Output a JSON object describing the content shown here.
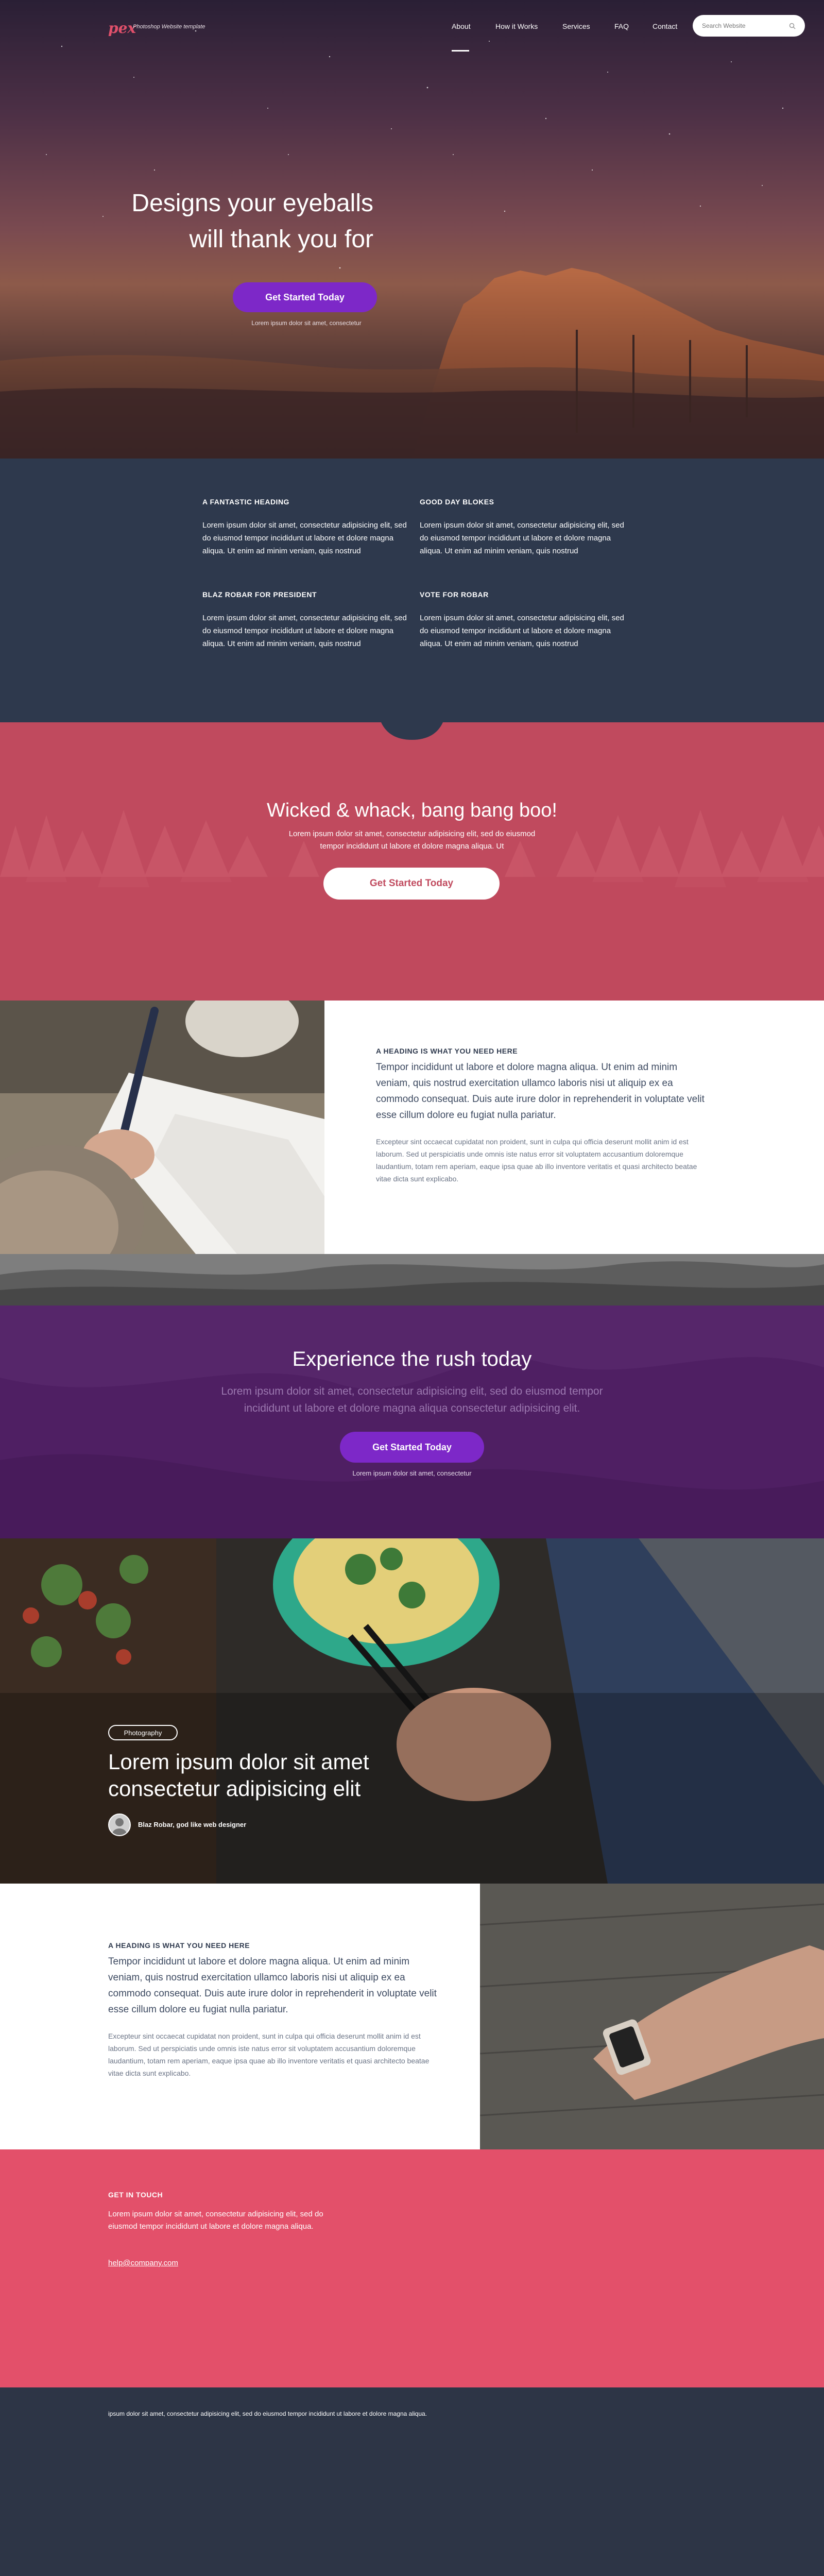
{
  "header": {
    "logo": "pex",
    "tagline": "Photoshop Website template",
    "nav": [
      "About",
      "How it Works",
      "Services",
      "FAQ",
      "Contact"
    ],
    "active_nav": "About",
    "search_placeholder": "Search Website",
    "search_icon": "search-icon"
  },
  "hero": {
    "title_line1": "Designs your eyeballs",
    "title_line2": "will thank you for",
    "button": "Get Started Today",
    "subtext": "Lorem ipsum dolor sit amet, consectetur"
  },
  "features": [
    {
      "heading": "A FANTASTIC HEADING",
      "text": "Lorem ipsum dolor sit amet, consectetur adipisicing elit, sed do eiusmod tempor incididunt ut labore et dolore magna aliqua. Ut enim ad minim veniam, quis nostrud"
    },
    {
      "heading": "GOOD DAY BLOKES",
      "text": "Lorem ipsum dolor sit amet, consectetur adipisicing elit, sed do eiusmod tempor incididunt ut labore et dolore magna aliqua. Ut enim ad minim veniam, quis nostrud"
    },
    {
      "heading": "BLAZ ROBAR FOR PRESIDENT",
      "text": "Lorem ipsum dolor sit amet, consectetur adipisicing elit, sed do eiusmod tempor incididunt ut labore et dolore magna aliqua. Ut enim ad minim veniam, quis nostrud"
    },
    {
      "heading": "VOTE FOR ROBAR",
      "text": "Lorem ipsum dolor sit amet, consectetur adipisicing elit, sed do eiusmod tempor incididunt ut labore et dolore magna aliqua. Ut enim ad minim veniam, quis nostrud"
    }
  ],
  "cta_red": {
    "title": "Wicked & whack, bang bang boo!",
    "text": "Lorem ipsum dolor sit amet, consectetur adipisicing elit, sed do eiusmod tempor incididunt ut labore et dolore magna aliqua. Ut",
    "button": "Get Started Today"
  },
  "split1": {
    "heading": "A HEADING IS WHAT YOU NEED HERE",
    "lead": "Tempor incididunt ut labore et dolore magna aliqua. Ut enim ad minim veniam, quis nostrud exercitation ullamco laboris nisi ut aliquip ex ea commodo consequat. Duis aute irure dolor in reprehenderit in voluptate velit esse cillum dolore eu fugiat nulla pariatur.",
    "body": "Excepteur sint occaecat cupidatat non proident, sunt in culpa qui officia deserunt mollit anim id est laborum. Sed ut perspiciatis unde omnis iste natus error sit voluptatem accusantium doloremque laudantium, totam rem aperiam, eaque ipsa quae ab illo inventore veritatis et quasi architecto beatae vitae dicta sunt explicabo."
  },
  "purple": {
    "title": "Experience the rush today",
    "text": "Lorem ipsum dolor sit amet, consectetur adipisicing elit, sed do eiusmod tempor incididunt ut labore et dolore magna aliqua consectetur adipisicing elit.",
    "button": "Get Started Today",
    "note": "Lorem ipsum dolor sit amet, consectetur"
  },
  "food": {
    "tag": "Photography",
    "title_line1": "Lorem ipsum dolor sit amet",
    "title_line2": "consectetur adipisicing elit",
    "author": "Blaz Robar, god like web designer"
  },
  "split2": {
    "heading": "A HEADING IS WHAT YOU NEED HERE",
    "lead": "Tempor incididunt ut labore et dolore magna aliqua. Ut enim ad minim veniam, quis nostrud exercitation ullamco laboris nisi ut aliquip ex ea commodo consequat. Duis aute irure dolor in reprehenderit in voluptate velit esse cillum dolore eu fugiat nulla pariatur.",
    "body": "Excepteur sint occaecat cupidatat non proident, sunt in culpa qui officia deserunt mollit anim id est laborum. Sed ut perspiciatis unde omnis iste natus error sit voluptatem accusantium doloremque laudantium, totam rem aperiam, eaque ipsa quae ab illo inventore veritatis et quasi architecto beatae vitae dicta sunt explicabo."
  },
  "contact": {
    "heading": "GET IN TOUCH",
    "text": "Lorem ipsum dolor sit amet, consectetur adipisicing elit, sed do eiusmod tempor incididunt ut labore et dolore magna aliqua.",
    "email": "help@company.com"
  },
  "footer": {
    "text": "ipsum dolor sit amet, consectetur adipisicing elit, sed do eiusmod tempor incididunt ut labore et dolore magna aliqua."
  },
  "colors": {
    "accent_purple": "#7d28c8",
    "red_band": "#c04a5e",
    "contact_red": "#e3506a",
    "navy": "#2e394d"
  }
}
